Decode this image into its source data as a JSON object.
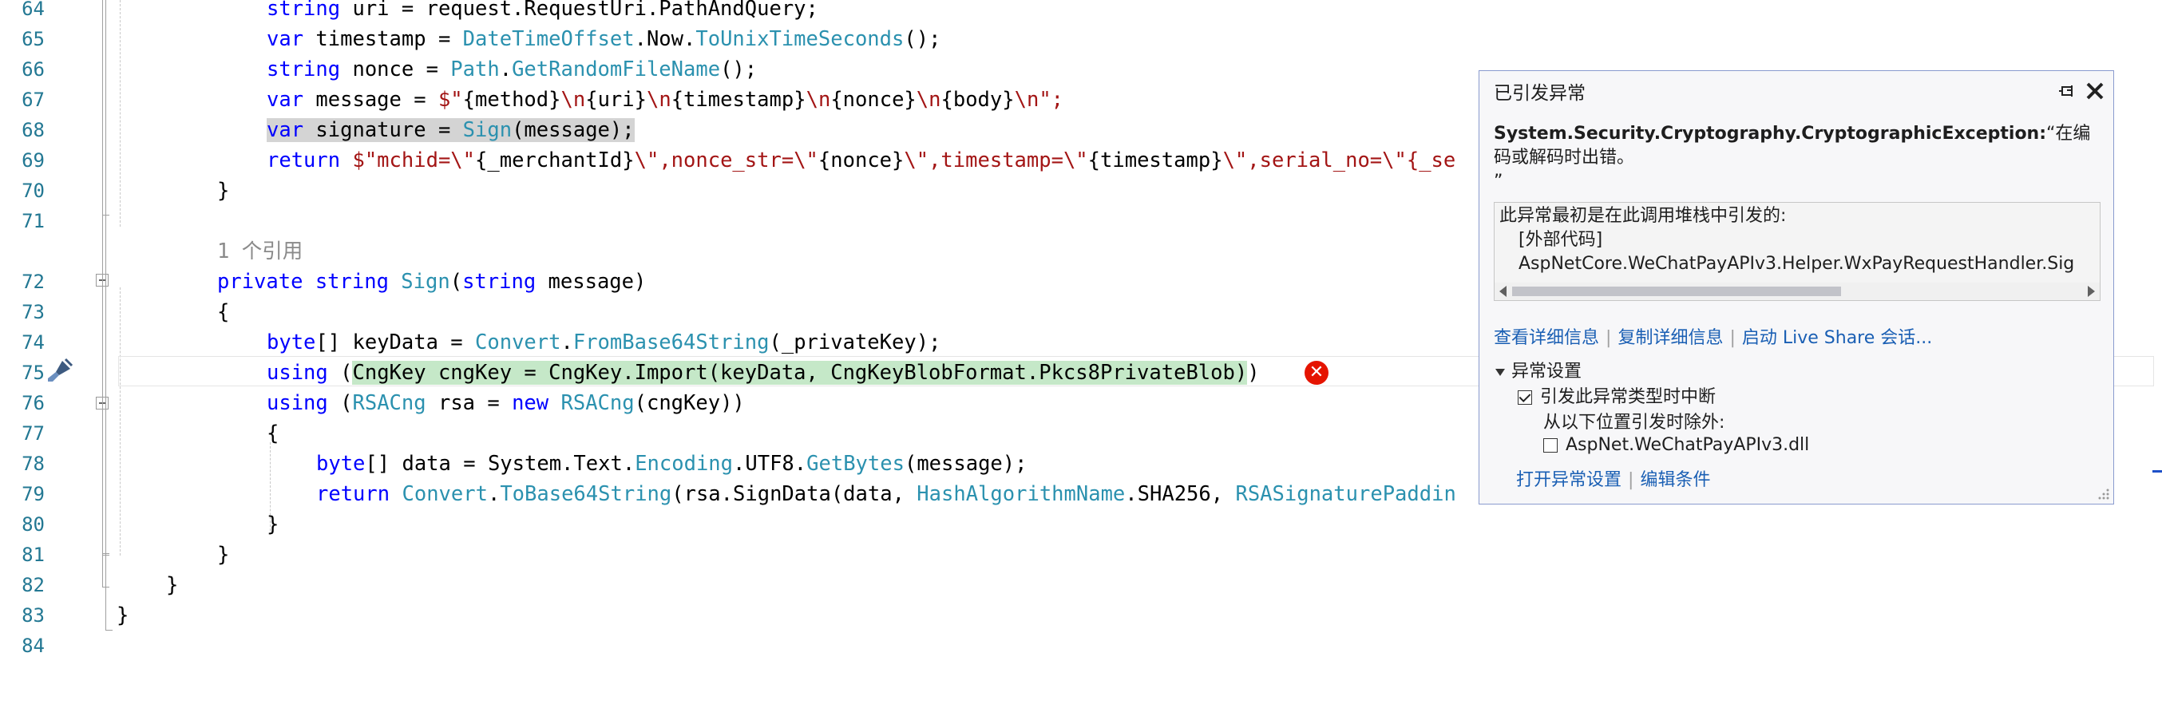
{
  "editor": {
    "line_numbers": [
      "64",
      "65",
      "66",
      "67",
      "68",
      "69",
      "70",
      "71",
      "72",
      "73",
      "74",
      "75",
      "76",
      "77",
      "78",
      "79",
      "80",
      "81",
      "82",
      "83",
      "84"
    ],
    "code": {
      "l64": {
        "type": "string",
        "rest": " uri = request.",
        "member": "RequestUri.PathAndQuery;"
      },
      "l65": {
        "kw": "var",
        "mid": " timestamp = ",
        "type": "DateTimeOffset",
        "rest": ".Now.",
        "method": "ToUnixTimeSeconds",
        "tail": "();"
      },
      "l66": {
        "kw": "string",
        "mid": " nonce = ",
        "type": "Path",
        "rest": ".",
        "method": "GetRandomFileName",
        "tail": "();"
      },
      "l67": {
        "kw": "var",
        "mid": " message = ",
        "str1": "$\"",
        "i1": "{method}",
        "s2": "\\n",
        "i2": "{uri}",
        "s3": "\\n",
        "i3": "{timestamp}",
        "s4": "\\n",
        "i4": "{nonce}",
        "s5": "\\n",
        "i5": "{body}",
        "s6": "\\n\";"
      },
      "l68": {
        "kw": "var",
        "mid": " signature = ",
        "method": "Sign",
        "tail": "(message);"
      },
      "l69": {
        "kw": "return",
        "str": " $\"mchid=\\\"",
        "i1": "{_merchantId}",
        "s2": "\\\",nonce_str=\\\"",
        "i2": "{nonce}",
        "s3": "\\\",timestamp=\\\"",
        "i3": "{timestamp}",
        "s4": "\\\",serial_no=\\\"{_se"
      },
      "l70": "}",
      "refcount": "1 个引用",
      "l72": {
        "kw1": "private",
        "kw2": " string",
        "name": " Sign",
        "tail1": "(",
        "kw3": "string",
        "tail2": " message)"
      },
      "l73": "{",
      "l74": {
        "kw": "byte",
        "mid": "[] keyData = ",
        "type": "Convert",
        "rest": ".",
        "method": "FromBase64String",
        "tail": "(_privateKey);"
      },
      "l75": {
        "kw": "using",
        "pre": " (",
        "hl": "CngKey cngKey = CngKey.Import(keyData, CngKeyBlobFormat.Pkcs8PrivateBlob)",
        "tail": ")"
      },
      "l76": {
        "kw": "using",
        "pre": " (",
        "type": "RSACng",
        "mid": " rsa = ",
        "kw2": "new",
        "type2": " RSACng",
        "tail": "(cngKey))"
      },
      "l77": "{",
      "l78": {
        "kw": "byte",
        "mid": "[] data = System.Text.",
        "type": "Encoding",
        "rest": ".UTF8.",
        "method": "GetBytes",
        "tail": "(message);"
      },
      "l79": {
        "kw": "return",
        "mid": " ",
        "type": "Convert",
        "rest": ".",
        "method": "ToBase64String",
        "tail": "(rsa.SignData(data, ",
        "type2": "HashAlgorithmName",
        "rest2": ".SHA256, ",
        "type3": "RSASignaturePaddin"
      },
      "l80": "}",
      "l81": "}",
      "l82": "}",
      "l83": "}"
    }
  },
  "popup": {
    "title": "已引发异常",
    "exception_type": "System.Security.Cryptography.CryptographicException:",
    "exception_msg1": "“在编",
    "exception_msg2": "码或解码时出错。",
    "exception_msg3": "”",
    "stack_header": "此异常最初是在此调用堆栈中引发的:",
    "stack_line1": "[外部代码]",
    "stack_line2": "AspNetCore.WeChatPayAPIv3.Helper.WxPayRequestHandler.Sig",
    "link_details": "查看详细信息",
    "link_copy": "复制详细信息",
    "link_liveshare": "启动 Live Share 会话...",
    "settings_title": "异常设置",
    "break_on_type": "引发此异常类型时中断",
    "except_when": "从以下位置引发时除外:",
    "except_module": "AspNet.WeChatPayAPIv3.dll",
    "link_open_settings": "打开异常设置",
    "link_edit_conditions": "编辑条件"
  },
  "colors": {
    "keyword": "#0000ff",
    "type": "#2b91af",
    "string": "#a31515",
    "line_number": "#237893",
    "selection": "#d4d4d4",
    "highlight": "#c5e8c8",
    "error": "#e51400",
    "link": "#1a5fb4"
  }
}
